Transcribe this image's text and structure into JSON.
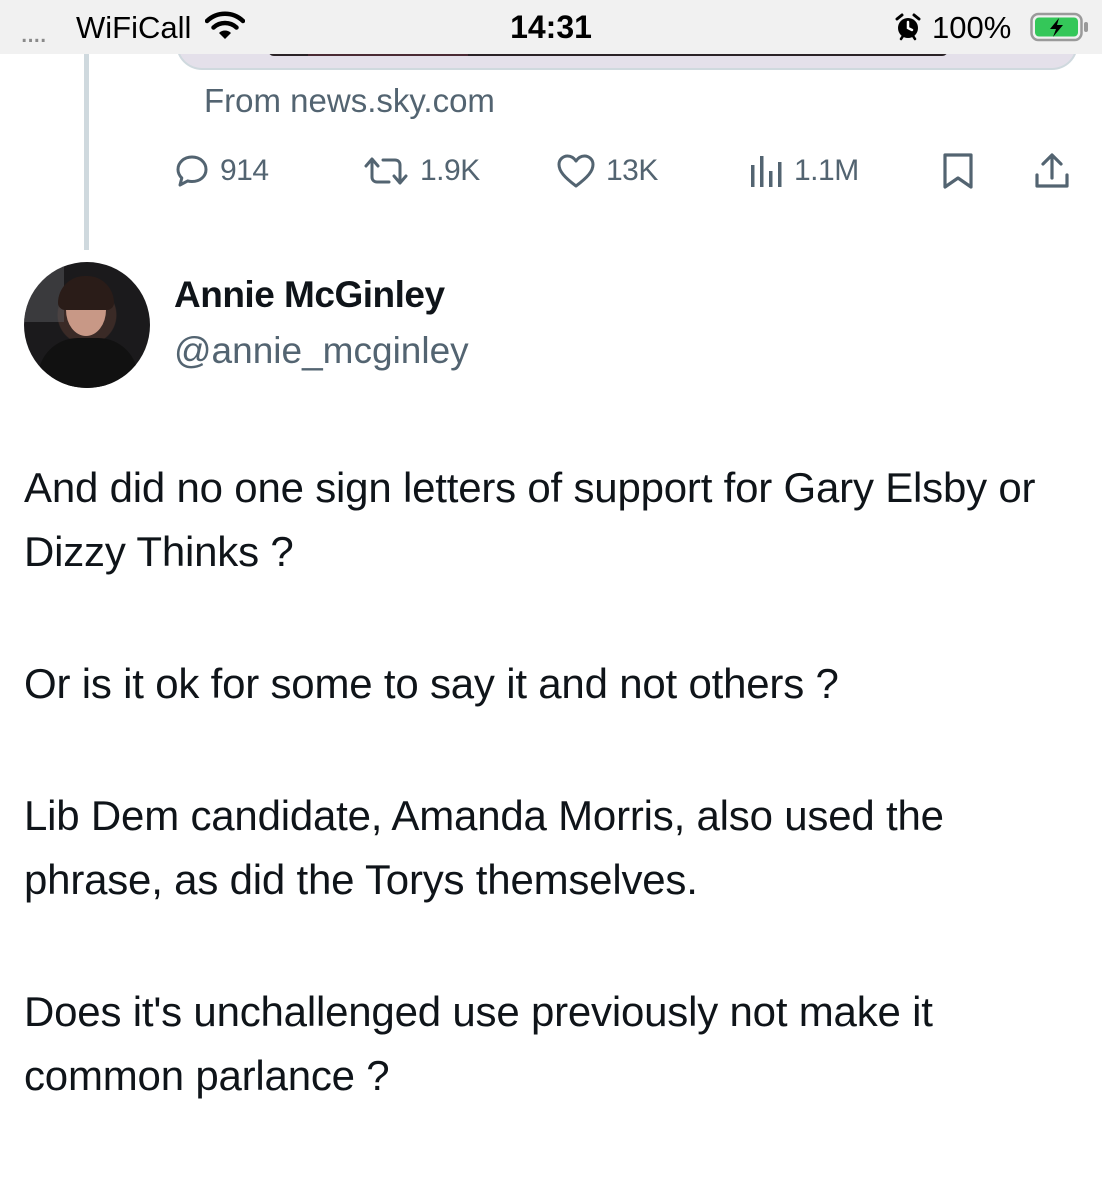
{
  "status_bar": {
    "signal": "....",
    "carrier": "WiFiCall",
    "time": "14:31",
    "battery": "100%"
  },
  "tweet_above": {
    "source": "From news.sky.com",
    "actions": {
      "replies": "914",
      "reposts": "1.9K",
      "likes": "13K",
      "views": "1.1M"
    }
  },
  "reply": {
    "author_name": "Annie McGinley",
    "author_handle": "@annie_mcginley",
    "paragraphs": [
      "And did no one sign letters of support for Gary Elsby or Dizzy Thinks ?",
      "Or is it ok for some to say it and not others ?",
      "Lib Dem candidate, Amanda Morris, also used the phrase, as did the Torys themselves.",
      "Does it's unchallenged use previously not make it common parlance ?"
    ]
  },
  "colors": {
    "text_primary": "#0f1419",
    "text_secondary": "#536471",
    "border": "#cfd9de",
    "battery_charging": "#34c759"
  },
  "icons": {
    "wifi": "wifi-icon",
    "alarm": "alarm-icon",
    "battery": "battery-charging-icon",
    "reply": "reply-icon",
    "repost": "repost-icon",
    "like": "heart-icon",
    "views": "views-bar-chart-icon",
    "bookmark": "bookmark-icon",
    "share": "share-icon"
  }
}
